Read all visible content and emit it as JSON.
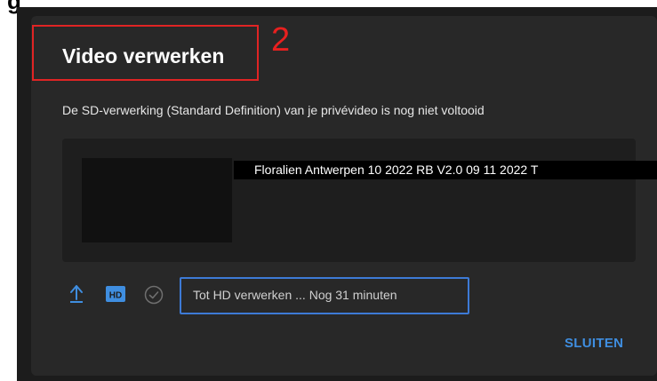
{
  "page": {
    "cut_heading": "g"
  },
  "dialog": {
    "title": "Video verwerken",
    "step_number": "2",
    "subtitle": "De SD-verwerking (Standard Definition) van je privévideo is nog niet voltooid",
    "video": {
      "filename": "Floralien Antwerpen 10 2022 RB V2.0 09 11 2022 T"
    },
    "status": {
      "text": "Tot HD verwerken ... Nog 31 minuten",
      "hd_badge": "HD"
    },
    "close_label": "SLUITEN"
  },
  "icons": {
    "upload": "upload-arrow-icon",
    "hd": "hd-badge-icon",
    "check": "check-circle-icon"
  },
  "colors": {
    "annotation_red": "#e02424",
    "accent_blue": "#3f8ee0",
    "dialog_bg": "#282828"
  }
}
